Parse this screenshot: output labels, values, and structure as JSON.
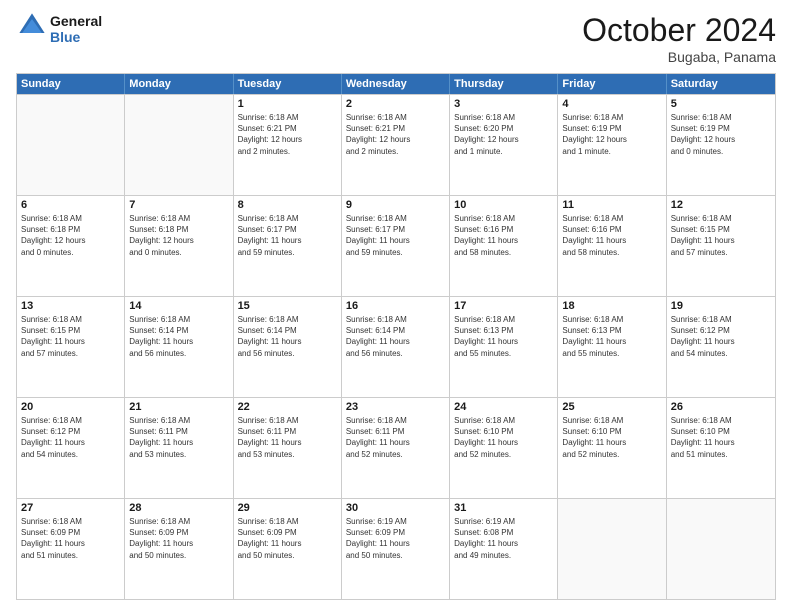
{
  "header": {
    "logo_general": "General",
    "logo_blue": "Blue",
    "month_title": "October 2024",
    "location": "Bugaba, Panama"
  },
  "days_of_week": [
    "Sunday",
    "Monday",
    "Tuesday",
    "Wednesday",
    "Thursday",
    "Friday",
    "Saturday"
  ],
  "weeks": [
    [
      {
        "day": "",
        "empty": true,
        "info": ""
      },
      {
        "day": "",
        "empty": true,
        "info": ""
      },
      {
        "day": "1",
        "info": "Sunrise: 6:18 AM\nSunset: 6:21 PM\nDaylight: 12 hours\nand 2 minutes."
      },
      {
        "day": "2",
        "info": "Sunrise: 6:18 AM\nSunset: 6:21 PM\nDaylight: 12 hours\nand 2 minutes."
      },
      {
        "day": "3",
        "info": "Sunrise: 6:18 AM\nSunset: 6:20 PM\nDaylight: 12 hours\nand 1 minute."
      },
      {
        "day": "4",
        "info": "Sunrise: 6:18 AM\nSunset: 6:19 PM\nDaylight: 12 hours\nand 1 minute."
      },
      {
        "day": "5",
        "info": "Sunrise: 6:18 AM\nSunset: 6:19 PM\nDaylight: 12 hours\nand 0 minutes."
      }
    ],
    [
      {
        "day": "6",
        "info": "Sunrise: 6:18 AM\nSunset: 6:18 PM\nDaylight: 12 hours\nand 0 minutes."
      },
      {
        "day": "7",
        "info": "Sunrise: 6:18 AM\nSunset: 6:18 PM\nDaylight: 12 hours\nand 0 minutes."
      },
      {
        "day": "8",
        "info": "Sunrise: 6:18 AM\nSunset: 6:17 PM\nDaylight: 11 hours\nand 59 minutes."
      },
      {
        "day": "9",
        "info": "Sunrise: 6:18 AM\nSunset: 6:17 PM\nDaylight: 11 hours\nand 59 minutes."
      },
      {
        "day": "10",
        "info": "Sunrise: 6:18 AM\nSunset: 6:16 PM\nDaylight: 11 hours\nand 58 minutes."
      },
      {
        "day": "11",
        "info": "Sunrise: 6:18 AM\nSunset: 6:16 PM\nDaylight: 11 hours\nand 58 minutes."
      },
      {
        "day": "12",
        "info": "Sunrise: 6:18 AM\nSunset: 6:15 PM\nDaylight: 11 hours\nand 57 minutes."
      }
    ],
    [
      {
        "day": "13",
        "info": "Sunrise: 6:18 AM\nSunset: 6:15 PM\nDaylight: 11 hours\nand 57 minutes."
      },
      {
        "day": "14",
        "info": "Sunrise: 6:18 AM\nSunset: 6:14 PM\nDaylight: 11 hours\nand 56 minutes."
      },
      {
        "day": "15",
        "info": "Sunrise: 6:18 AM\nSunset: 6:14 PM\nDaylight: 11 hours\nand 56 minutes."
      },
      {
        "day": "16",
        "info": "Sunrise: 6:18 AM\nSunset: 6:14 PM\nDaylight: 11 hours\nand 56 minutes."
      },
      {
        "day": "17",
        "info": "Sunrise: 6:18 AM\nSunset: 6:13 PM\nDaylight: 11 hours\nand 55 minutes."
      },
      {
        "day": "18",
        "info": "Sunrise: 6:18 AM\nSunset: 6:13 PM\nDaylight: 11 hours\nand 55 minutes."
      },
      {
        "day": "19",
        "info": "Sunrise: 6:18 AM\nSunset: 6:12 PM\nDaylight: 11 hours\nand 54 minutes."
      }
    ],
    [
      {
        "day": "20",
        "info": "Sunrise: 6:18 AM\nSunset: 6:12 PM\nDaylight: 11 hours\nand 54 minutes."
      },
      {
        "day": "21",
        "info": "Sunrise: 6:18 AM\nSunset: 6:11 PM\nDaylight: 11 hours\nand 53 minutes."
      },
      {
        "day": "22",
        "info": "Sunrise: 6:18 AM\nSunset: 6:11 PM\nDaylight: 11 hours\nand 53 minutes."
      },
      {
        "day": "23",
        "info": "Sunrise: 6:18 AM\nSunset: 6:11 PM\nDaylight: 11 hours\nand 52 minutes."
      },
      {
        "day": "24",
        "info": "Sunrise: 6:18 AM\nSunset: 6:10 PM\nDaylight: 11 hours\nand 52 minutes."
      },
      {
        "day": "25",
        "info": "Sunrise: 6:18 AM\nSunset: 6:10 PM\nDaylight: 11 hours\nand 52 minutes."
      },
      {
        "day": "26",
        "info": "Sunrise: 6:18 AM\nSunset: 6:10 PM\nDaylight: 11 hours\nand 51 minutes."
      }
    ],
    [
      {
        "day": "27",
        "info": "Sunrise: 6:18 AM\nSunset: 6:09 PM\nDaylight: 11 hours\nand 51 minutes."
      },
      {
        "day": "28",
        "info": "Sunrise: 6:18 AM\nSunset: 6:09 PM\nDaylight: 11 hours\nand 50 minutes."
      },
      {
        "day": "29",
        "info": "Sunrise: 6:18 AM\nSunset: 6:09 PM\nDaylight: 11 hours\nand 50 minutes."
      },
      {
        "day": "30",
        "info": "Sunrise: 6:19 AM\nSunset: 6:09 PM\nDaylight: 11 hours\nand 50 minutes."
      },
      {
        "day": "31",
        "info": "Sunrise: 6:19 AM\nSunset: 6:08 PM\nDaylight: 11 hours\nand 49 minutes."
      },
      {
        "day": "",
        "empty": true,
        "info": ""
      },
      {
        "day": "",
        "empty": true,
        "info": ""
      }
    ]
  ]
}
